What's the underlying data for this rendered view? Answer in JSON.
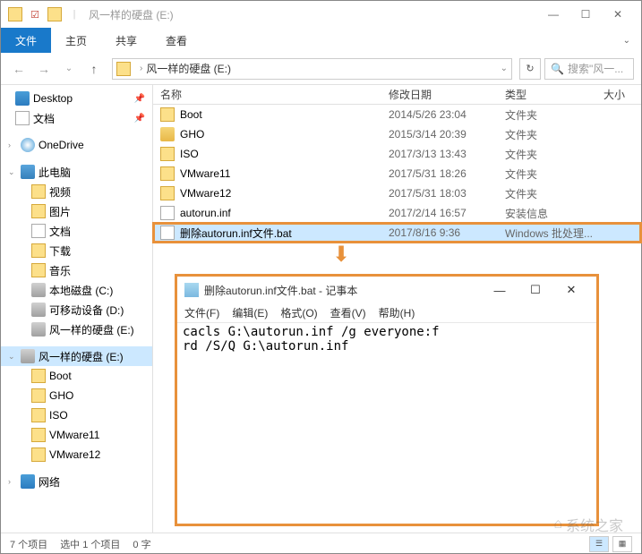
{
  "window": {
    "title": "风一样的硬盘 (E:)",
    "title_prefix": " | "
  },
  "ribbon": {
    "file": "文件",
    "home": "主页",
    "share": "共享",
    "view": "查看"
  },
  "address": {
    "path": "风一样的硬盘 (E:)"
  },
  "search": {
    "placeholder": "搜索\"风一..."
  },
  "columns": {
    "name": "名称",
    "date": "修改日期",
    "type": "类型",
    "size": "大小"
  },
  "sidebar": {
    "desktop": "Desktop",
    "docs": "文档",
    "onedrive": "OneDrive",
    "thispc": "此电脑",
    "video": "视频",
    "pictures": "图片",
    "docs2": "文档",
    "downloads": "下载",
    "music": "音乐",
    "c": "本地磁盘 (C:)",
    "d": "可移动设备 (D:)",
    "e": "风一样的硬盘 (E:)",
    "e2": "风一样的硬盘 (E:)",
    "boot": "Boot",
    "gho": "GHO",
    "iso": "ISO",
    "vm11": "VMware11",
    "vm12": "VMware12",
    "network": "网络"
  },
  "files": [
    {
      "name": "Boot",
      "date": "2014/5/26 23:04",
      "type": "文件夹",
      "ico": "ico-folder"
    },
    {
      "name": "GHO",
      "date": "2015/3/14 20:39",
      "type": "文件夹",
      "ico": "ico-gho"
    },
    {
      "name": "ISO",
      "date": "2017/3/13 13:43",
      "type": "文件夹",
      "ico": "ico-folder"
    },
    {
      "name": "VMware11",
      "date": "2017/5/31 18:26",
      "type": "文件夹",
      "ico": "ico-folder"
    },
    {
      "name": "VMware12",
      "date": "2017/5/31 18:03",
      "type": "文件夹",
      "ico": "ico-folder"
    },
    {
      "name": "autorun.inf",
      "date": "2017/2/14 16:57",
      "type": "安装信息",
      "ico": "ico-inf"
    },
    {
      "name": "删除autorun.inf文件.bat",
      "date": "2017/8/16 9:36",
      "type": "Windows 批处理...",
      "ico": "ico-bat",
      "selected": true
    }
  ],
  "notepad": {
    "title": "删除autorun.inf文件.bat - 记事本",
    "menu": {
      "file": "文件(F)",
      "edit": "编辑(E)",
      "format": "格式(O)",
      "view": "查看(V)",
      "help": "帮助(H)"
    },
    "content": "cacls G:\\autorun.inf /g everyone:f\nrd /S/Q G:\\autorun.inf"
  },
  "status": {
    "items": "7 个项目",
    "selected": "选中 1 个项目",
    "bytes": "0 字"
  },
  "watermark": "系统之家"
}
